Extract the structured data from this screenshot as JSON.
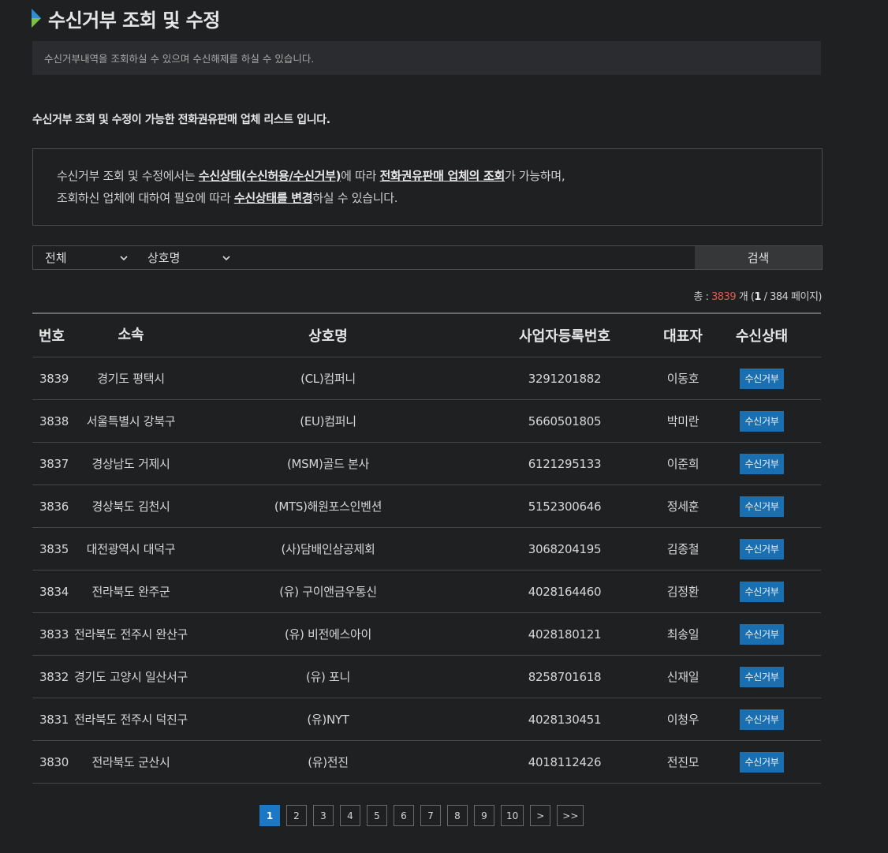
{
  "page": {
    "title": "수신거부 조회 및 수정",
    "description": "수신거부내역을 조회하실 수 있으며 수신해제를 하실 수 있습니다.",
    "subheading": "수신거부 조회 및 수정이 가능한 전화권유판매 업체 리스트 입니다."
  },
  "notice": {
    "line1_a": "수신거부 조회 및 수정에서는 ",
    "line1_b": "수신상태(수신허용/수신거부)",
    "line1_c": "에 따라 ",
    "line1_d": "전화권유판매 업체의 조회",
    "line1_e": "가 가능하며,",
    "line2_a": "조회하신 업체에 대하여 필요에 따라 ",
    "line2_b": "수신상태를 변경",
    "line2_c": "하실 수 있습니다."
  },
  "search": {
    "filter1": "전체",
    "filter2": "상호명",
    "query": "",
    "button": "검색"
  },
  "total": {
    "prefix": "총 : ",
    "count": "3839",
    "suffix1": " 개 (",
    "page": "1",
    "suffix2": " / 384 페이지)"
  },
  "table": {
    "headers": [
      "번호",
      "소속",
      "상호명",
      "사업자등록번호",
      "대표자",
      "수신상태"
    ],
    "rows": [
      {
        "no": "3839",
        "org": "경기도 평택시",
        "name": "(CL)컴퍼니",
        "biz": "3291201882",
        "rep": "이동호",
        "status": "수신거부"
      },
      {
        "no": "3838",
        "org": "서울특별시 강북구",
        "name": "(EU)컴퍼니",
        "biz": "5660501805",
        "rep": "박미란",
        "status": "수신거부"
      },
      {
        "no": "3837",
        "org": "경상남도 거제시",
        "name": "(MSM)골드 본사",
        "biz": "6121295133",
        "rep": "이준희",
        "status": "수신거부"
      },
      {
        "no": "3836",
        "org": "경상북도 김천시",
        "name": "(MTS)해원포스인벤션",
        "biz": "5152300646",
        "rep": "정세훈",
        "status": "수신거부"
      },
      {
        "no": "3835",
        "org": "대전광역시 대덕구",
        "name": "(사)담배인삼공제회",
        "biz": "3068204195",
        "rep": "김종철",
        "status": "수신거부"
      },
      {
        "no": "3834",
        "org": "전라북도 완주군",
        "name": "(유) 구이앤금우통신",
        "biz": "4028164460",
        "rep": "김정환",
        "status": "수신거부"
      },
      {
        "no": "3833",
        "org": "전라북도 전주시 완산구",
        "name": "(유) 비전에스아이",
        "biz": "4028180121",
        "rep": "최송일",
        "status": "수신거부"
      },
      {
        "no": "3832",
        "org": "경기도 고양시 일산서구",
        "name": "(유) 포니",
        "biz": "8258701618",
        "rep": "신재일",
        "status": "수신거부"
      },
      {
        "no": "3831",
        "org": "전라북도 전주시 덕진구",
        "name": "(유)NYT",
        "biz": "4028130451",
        "rep": "이청우",
        "status": "수신거부"
      },
      {
        "no": "3830",
        "org": "전라북도 군산시",
        "name": "(유)전진",
        "biz": "4018112426",
        "rep": "전진모",
        "status": "수신거부"
      }
    ]
  },
  "pagination": {
    "pages": [
      "1",
      "2",
      "3",
      "4",
      "5",
      "6",
      "7",
      "8",
      "9",
      "10"
    ],
    "next": ">",
    "last": ">>",
    "active": "1"
  },
  "colors": {
    "background": "#1f2022",
    "accent_blue": "#1b78c7",
    "count_red": "#e05b4b",
    "title_mark_blue": "#2a8fd6",
    "title_mark_green": "#7cc242"
  }
}
